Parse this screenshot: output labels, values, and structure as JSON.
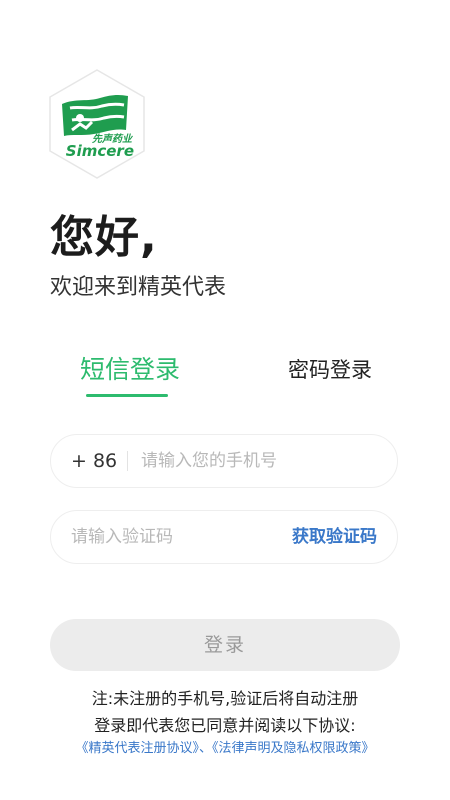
{
  "brand": {
    "logo_cn": "先声药业",
    "logo_en": "Simcere",
    "logo_green": "#1f9d4f"
  },
  "header": {
    "greeting": "您好,",
    "welcome": "欢迎来到精英代表"
  },
  "tabs": [
    {
      "label": "短信登录",
      "active": true
    },
    {
      "label": "密码登录",
      "active": false
    }
  ],
  "form": {
    "phone_prefix": "+ 86",
    "phone_placeholder": "请输入您的手机号",
    "code_placeholder": "请输入验证码",
    "get_code_label": "获取验证码",
    "login_label": "登录"
  },
  "footer": {
    "note_line1": "注:未注册的手机号,验证后将自动注册",
    "note_line2": "登录即代表您已同意并阅读以下协议:",
    "link_register": "《精英代表注册协议》",
    "link_separator": "、",
    "link_privacy": "《法律声明及隐私权限政策》"
  },
  "colors": {
    "accent_green": "#2dbb6e",
    "link_blue": "#3a78c9",
    "button_disabled_bg": "#ececec"
  }
}
